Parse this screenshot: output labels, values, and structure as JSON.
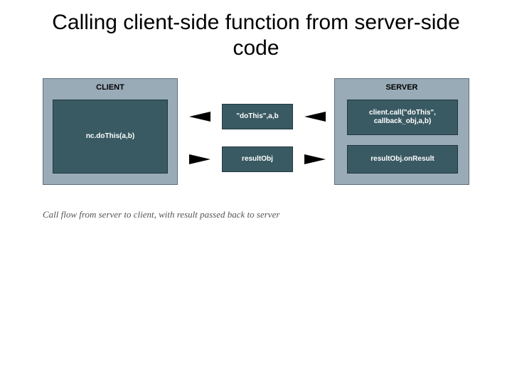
{
  "title": "Calling client-side function from server-side code",
  "diagram": {
    "client": {
      "label": "CLIENT",
      "inner": "nc.doThis(a,b)"
    },
    "server": {
      "label": "SERVER",
      "box1": "client.call(\"doThis\", callback_obj,a,b)",
      "box2": "resultObj.onResult"
    },
    "middle": {
      "top": "\"doThis\",a,b",
      "bottom": "resultObj"
    }
  },
  "caption": "Call flow from server to client, with result passed back to server"
}
